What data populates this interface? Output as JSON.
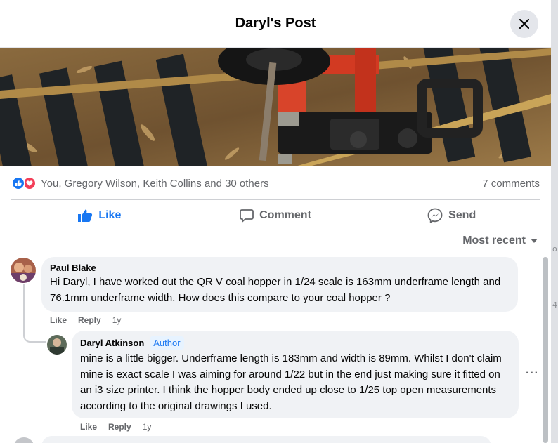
{
  "header": {
    "title": "Daryl's Post"
  },
  "reactions": {
    "icons": [
      "like-icon",
      "love-icon"
    ],
    "summary": "You, Gregory Wilson, Keith Collins and 30 others",
    "comment_count": "7 comments"
  },
  "actions": {
    "like": "Like",
    "comment": "Comment",
    "send": "Send"
  },
  "sort": {
    "label": "Most recent"
  },
  "comments": [
    {
      "author": "Paul Blake",
      "text": "Hi Daryl, I have worked out the QR V coal hopper in 1/24 scale is 163mm underframe length and 76.1mm underframe width. How does this compare to your coal hopper ?",
      "like": "Like",
      "reply": "Reply",
      "time": "1y"
    },
    {
      "author": "Daryl Atkinson",
      "badge": "Author",
      "text": "mine is a little bigger. Underframe length is 183mm and width is 89mm. Whilst I don't claim mine is exact scale I was aiming for around 1/22 but in the end just making sure it fitted on an i3 size printer. I think the hopper body ended up close to 1/25 top open measurements according to the original drawings I used.",
      "like": "Like",
      "reply": "Reply",
      "time": "1y"
    }
  ],
  "more_options": "···",
  "background_glyphs": [
    "o",
    "4"
  ],
  "colors": {
    "accent": "#1877f2",
    "love": "#f33e58",
    "bubble": "#f0f2f5",
    "muted": "#65676b"
  }
}
